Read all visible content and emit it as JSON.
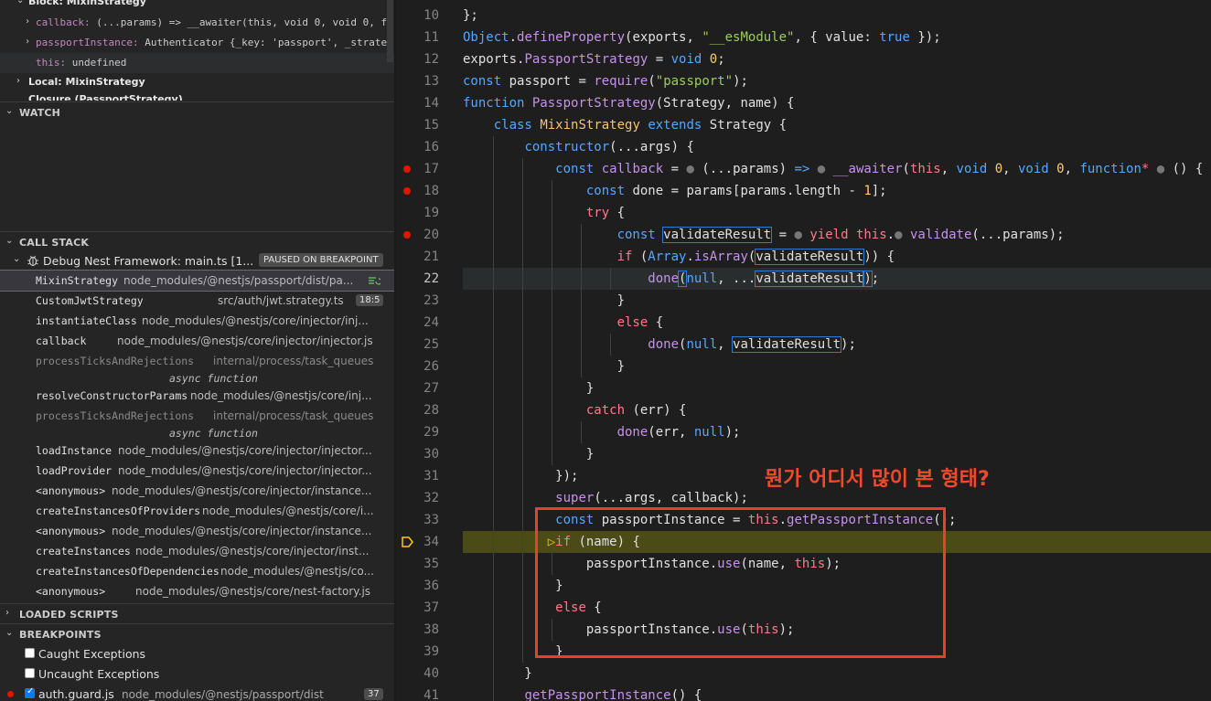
{
  "variables": {
    "block_header": "Block: MixinStrategy",
    "rows": [
      {
        "key": "callback:",
        "value": " (...params) => __awaiter(this, void 0, void 0, f..."
      },
      {
        "key": "passportInstance:",
        "value": " Authenticator {_key: 'passport', _strate..."
      },
      {
        "key": "this:",
        "value": " undefined"
      }
    ],
    "local_header": "Local: MixinStrategy",
    "closure_header": "Closure (PassportStrategy)"
  },
  "sections": {
    "watch": "WATCH",
    "call_stack": "CALL STACK",
    "loaded_scripts": "LOADED SCRIPTS",
    "breakpoints": "BREAKPOINTS"
  },
  "call_stack": {
    "session": "Debug Nest Framework: main.ts [1...",
    "status": "PAUSED ON BREAKPOINT",
    "frames": [
      {
        "fn": "MixinStrategy",
        "path": "node_modules/@nestjs/passport/dist/pa...",
        "badge": ""
      },
      {
        "fn": "CustomJwtStrategy",
        "path": "src/auth/jwt.strategy.ts",
        "badge": "18:5"
      },
      {
        "fn": "instantiateClass",
        "path": "node_modules/@nestjs/core/injector/inj...",
        "badge": ""
      },
      {
        "fn": "callback",
        "path": "node_modules/@nestjs/core/injector/injector.js",
        "badge": ""
      },
      {
        "fn": "processTicksAndRejections",
        "path": "internal/process/task_queues",
        "badge": ""
      },
      {
        "fn": "resolveConstructorParams",
        "path": "node_modules/@nestjs/core/inj...",
        "badge": ""
      },
      {
        "fn": "processTicksAndRejections",
        "path": "internal/process/task_queues",
        "badge": ""
      },
      {
        "fn": "loadInstance",
        "path": "node_modules/@nestjs/core/injector/injector...",
        "badge": ""
      },
      {
        "fn": "loadProvider",
        "path": "node_modules/@nestjs/core/injector/injector...",
        "badge": ""
      },
      {
        "fn": "<anonymous>",
        "path": "node_modules/@nestjs/core/injector/instance...",
        "badge": ""
      },
      {
        "fn": "createInstancesOfProviders",
        "path": "node_modules/@nestjs/core/i...",
        "badge": ""
      },
      {
        "fn": "<anonymous>",
        "path": "node_modules/@nestjs/core/injector/instance...",
        "badge": ""
      },
      {
        "fn": "createInstances",
        "path": "node_modules/@nestjs/core/injector/inst...",
        "badge": ""
      },
      {
        "fn": "createInstancesOfDependencies",
        "path": "node_modules/@nestjs/co...",
        "badge": ""
      },
      {
        "fn": "<anonymous>",
        "path": "node_modules/@nestjs/core/nest-factory.js",
        "badge": ""
      }
    ],
    "async_label": "async function"
  },
  "breakpoints": [
    {
      "label": "Caught Exceptions",
      "checked": false,
      "path": "",
      "count": ""
    },
    {
      "label": "Uncaught Exceptions",
      "checked": false,
      "path": "",
      "count": ""
    },
    {
      "label": "auth.guard.js",
      "checked": true,
      "path": "node_modules/@nestjs/passport/dist",
      "count": "37"
    }
  ],
  "editor": {
    "line_numbers": [
      "10",
      "11",
      "12",
      "13",
      "14",
      "15",
      "16",
      "17",
      "18",
      "19",
      "20",
      "21",
      "22",
      "23",
      "24",
      "25",
      "26",
      "27",
      "28",
      "29",
      "30",
      "31",
      "32",
      "33",
      "34",
      "35",
      "36",
      "37",
      "38",
      "39",
      "40",
      "41"
    ],
    "annotation": "뭔가 어디서 많이 본 형태?"
  },
  "colors": {
    "accent_red": "#e8402a",
    "breakpoint": "#e51400",
    "keyword": "#57a7ff",
    "current_stop_bg": "#4b4b18"
  }
}
